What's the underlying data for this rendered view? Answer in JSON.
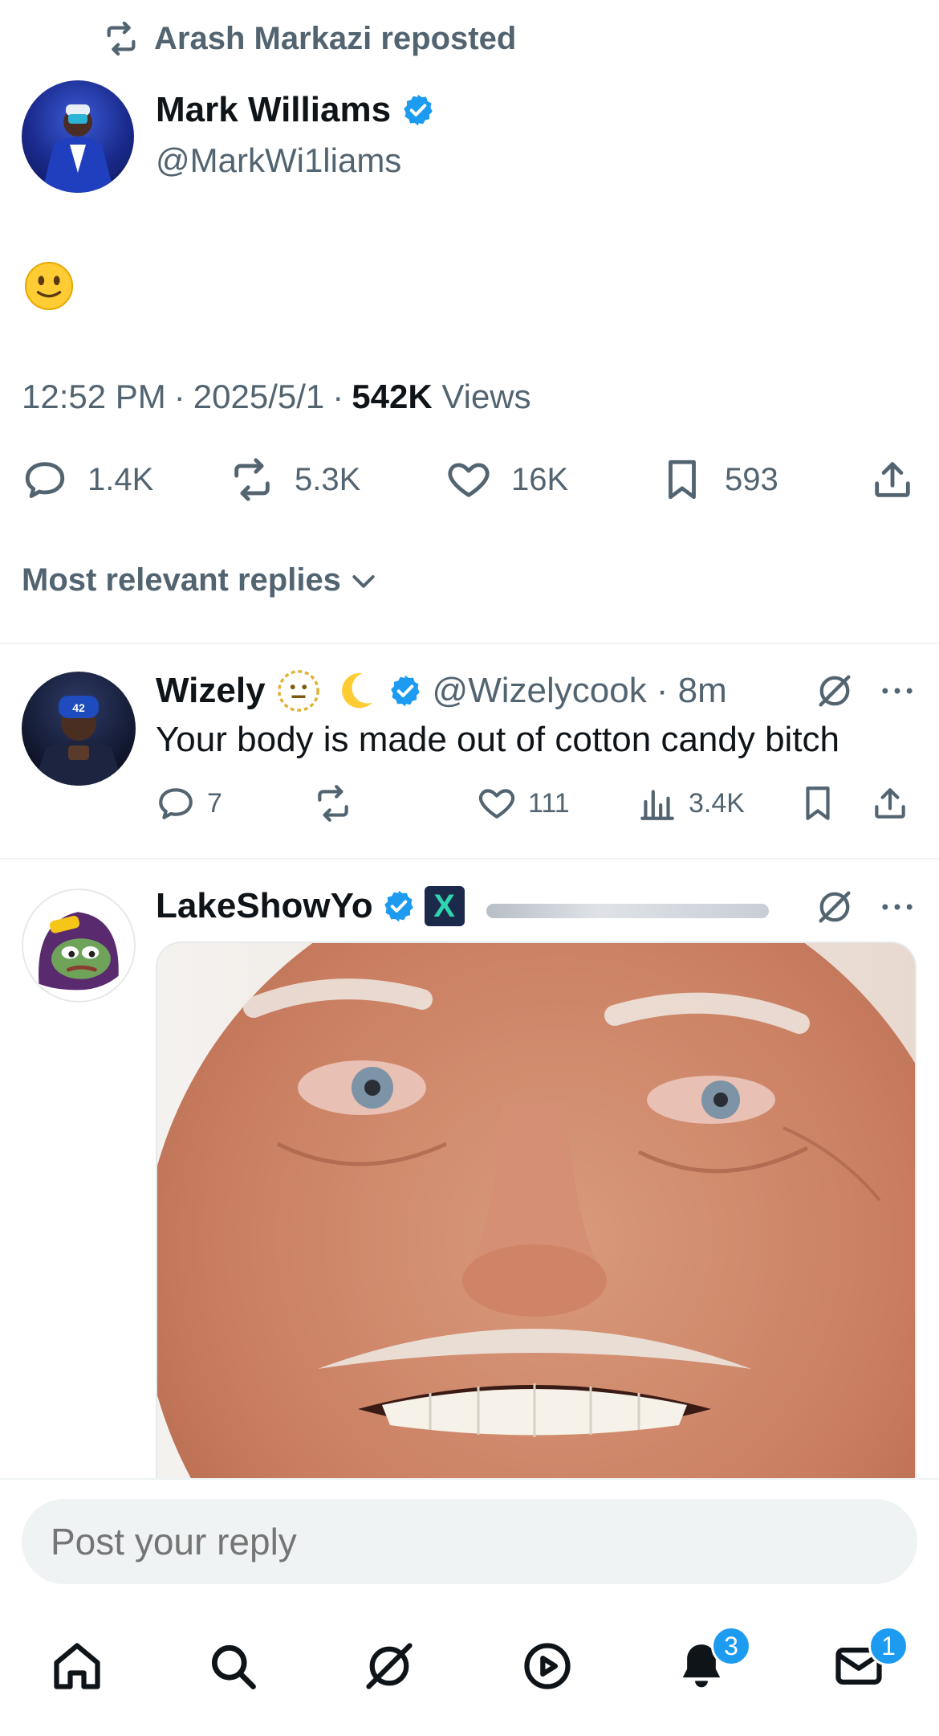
{
  "colors": {
    "accent": "#1d9bf0",
    "text": "#0f1419",
    "secondary": "#536471",
    "divider": "#eff3f4"
  },
  "repost": {
    "label": "Arash Markazi reposted",
    "icon": "repost-icon"
  },
  "tweet": {
    "author_name": "Mark Williams",
    "author_handle": "@MarkWi1liams",
    "body_emoji": "slightly-smiling-face-emoji",
    "time": "12:52 PM",
    "date": "2025/5/1",
    "views": "542K",
    "views_label": "Views",
    "separator": "·",
    "stats": {
      "replies": "1.4K",
      "reposts": "5.3K",
      "likes": "16K",
      "bookmarks": "593"
    }
  },
  "sort": {
    "label": "Most relevant replies"
  },
  "replies": [
    {
      "name": "Wizely",
      "handle": "@Wizelycook",
      "time": "· 8m",
      "text": "Your body is made out of cotton candy bitch",
      "stats": {
        "replies": "7",
        "reposts": "",
        "likes": "111",
        "views": "3.4K"
      }
    },
    {
      "name": "LakeShowYo",
      "badge": "X",
      "image": "smiling-older-man-closeup-photo"
    }
  ],
  "reply_box": {
    "placeholder": "Post your reply"
  },
  "nav": {
    "items": [
      "home",
      "search",
      "grok",
      "video",
      "notifications",
      "messages"
    ],
    "notifications_badge": "3",
    "messages_badge": "1"
  }
}
